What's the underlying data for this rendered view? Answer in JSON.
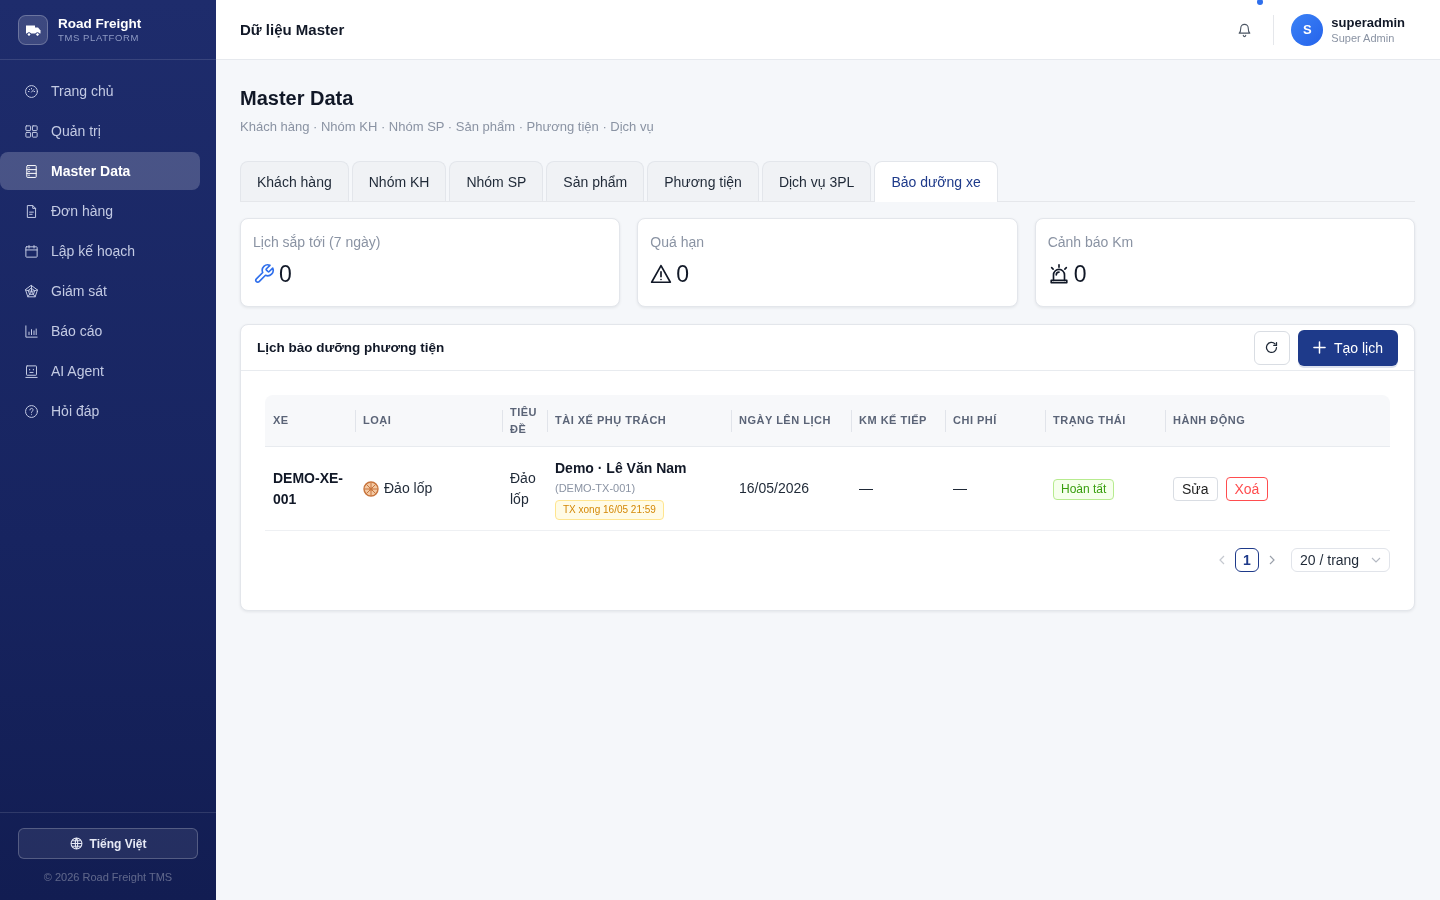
{
  "sidebar": {
    "brand": {
      "name": "Road Freight",
      "tagline": "TMS PLATFORM"
    },
    "items": [
      {
        "label": "Trang chủ",
        "selected": false
      },
      {
        "label": "Quản trị",
        "selected": false
      },
      {
        "label": "Master Data",
        "selected": true
      },
      {
        "label": "Đơn hàng",
        "selected": false
      },
      {
        "label": "Lập kế hoạch",
        "selected": false
      },
      {
        "label": "Giám sát",
        "selected": false
      },
      {
        "label": "Báo cáo",
        "selected": false
      },
      {
        "label": "AI Agent",
        "selected": false
      },
      {
        "label": "Hỏi đáp",
        "selected": false
      }
    ],
    "language_button": "Tiếng Việt",
    "copyright": "© 2026 Road Freight TMS"
  },
  "header": {
    "title": "Dữ liệu Master",
    "has_unread": true,
    "user": {
      "initial": "S",
      "name": "superadmin",
      "role": "Super Admin"
    }
  },
  "page": {
    "title": "Master Data",
    "subtitle": "Khách hàng · Nhóm KH · Nhóm SP · Sản phẩm · Phương tiện · Dịch vụ"
  },
  "tabs": [
    {
      "label": "Khách hàng",
      "selected": false
    },
    {
      "label": "Nhóm KH",
      "selected": false
    },
    {
      "label": "Nhóm SP",
      "selected": false
    },
    {
      "label": "Sản phẩm",
      "selected": false
    },
    {
      "label": "Phương tiện",
      "selected": false
    },
    {
      "label": "Dịch vụ 3PL",
      "selected": false
    },
    {
      "label": "Bảo dưỡng xe",
      "selected": true
    }
  ],
  "stats": [
    {
      "label": "Lịch sắp tới (7 ngày)",
      "value": "0"
    },
    {
      "label": "Quá hạn",
      "value": "0"
    },
    {
      "label": "Cảnh báo Km",
      "value": "0"
    }
  ],
  "schedule": {
    "title": "Lịch bảo dưỡng phương tiện",
    "create_button": "Tạo lịch",
    "table": {
      "columns": [
        "XE",
        "LOẠI",
        "TIÊU ĐỀ",
        "TÀI XẾ PHỤ TRÁCH",
        "NGÀY LÊN LỊCH",
        "KM KẾ TIẾP",
        "CHI PHÍ",
        "TRẠNG THÁI",
        "HÀNH ĐỘNG"
      ],
      "rows": [
        {
          "vehicle": "DEMO-XE-001",
          "type": "Đảo lốp",
          "title": "Đảo lốp",
          "driver": {
            "name": "Demo · Lê Văn Nam",
            "code": "(DEMO-TX-001)",
            "note": "TX xong 16/05 21:59"
          },
          "scheduled_date": "16/05/2026",
          "next_km": "—",
          "cost": "—",
          "status": "Hoàn tất",
          "actions": [
            {
              "label": "Sửa",
              "kind": "edit"
            },
            {
              "label": "Xoá",
              "kind": "delete"
            }
          ]
        }
      ]
    },
    "pagination": {
      "pages": [
        {
          "label": "1",
          "selected": true
        }
      ],
      "page_size": "20 / trang"
    }
  }
}
